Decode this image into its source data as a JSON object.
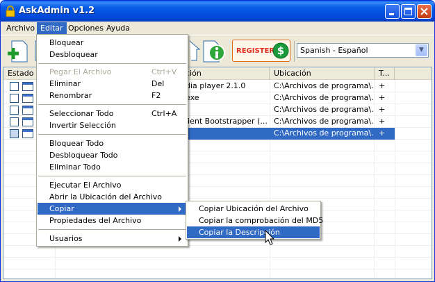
{
  "window": {
    "title": "AskAdmin v1.2"
  },
  "menubar": {
    "items": [
      "Archivo",
      "Editar",
      "Opciones",
      "Ayuda"
    ]
  },
  "toolbar": {
    "register_label": "REGISTER",
    "language": "Spanish - Español"
  },
  "list": {
    "columns": [
      "Estado",
      "ción",
      "Ubicación",
      "T..."
    ],
    "rows": [
      {
        "desc": "dia player 2.1.0",
        "location": "C:\\Archivos de programa\\...",
        "type": "+"
      },
      {
        "desc": "exe",
        "location": "C:\\Archivos de programa\\...",
        "type": "+"
      },
      {
        "desc": "",
        "location": "C:\\Archivos de programa\\...",
        "type": "+"
      },
      {
        "desc": "lient Bootstrapper (...",
        "location": "C:\\Archivos de programa\\...",
        "type": "+"
      },
      {
        "desc": "",
        "location": "C:\\Archivos de programa\\...",
        "type": "+"
      }
    ]
  },
  "editar_menu": {
    "bloquear": "Bloquear",
    "desbloquear": "Desbloquear",
    "pegar": "Pegar El Archivo",
    "pegar_sc": "Ctrl+V",
    "eliminar": "Eliminar",
    "eliminar_sc": "Del",
    "renombrar": "Renombrar",
    "renombrar_sc": "F2",
    "seleccionar_todo": "Seleccionar Todo",
    "seleccionar_todo_sc": "Ctrl+A",
    "invertir": "Invertir Selección",
    "bloquear_todo": "Bloquear Todo",
    "desbloquear_todo": "Desbloquear Todo",
    "eliminar_todo": "Eliminar Todo",
    "ejecutar": "Ejecutar El Archivo",
    "abrir_ubicacion": "Abrir la Ubicación del Archivo",
    "copiar": "Copiar",
    "propiedades": "Propiedades del Archivo",
    "usuarios": "Usuarios"
  },
  "copiar_submenu": {
    "ubicacion": "Copiar Ubicación del Archivo",
    "md5": "Copiar la comprobación del MD5",
    "descripcion": "Copiar la Descripción"
  }
}
